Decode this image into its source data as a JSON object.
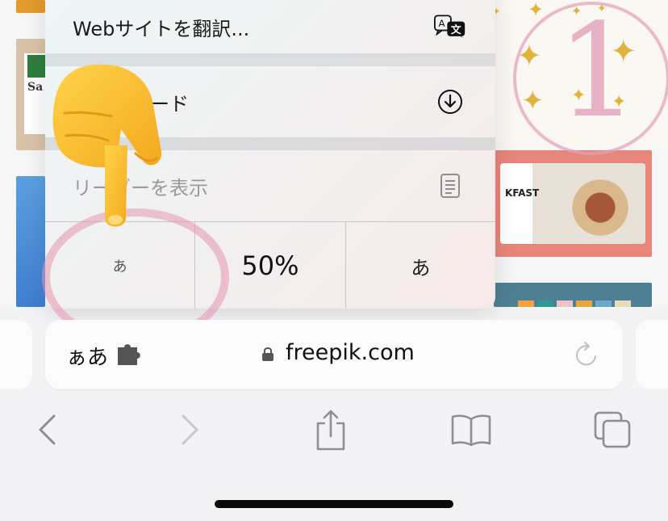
{
  "menu": {
    "translate_label": "Webサイトを翻訳...",
    "download_label": "ダウンロード",
    "reader_label": "リーダーを表示",
    "zoom_smaller": "あ",
    "zoom_level": "50%",
    "zoom_larger": "あ"
  },
  "address_bar": {
    "text_size_button": "ぁあ",
    "url": "freepik.com"
  },
  "background": {
    "salad_text": "Sa",
    "breakfast_text": "KFAST",
    "badge_number": "1"
  },
  "icons": {
    "translate": "translate-icon",
    "download": "download-icon",
    "reader": "reader-icon",
    "extension": "puzzle-icon",
    "lock": "lock-icon",
    "reload": "reload-icon",
    "back": "chevron-left-icon",
    "forward": "chevron-right-icon",
    "share": "share-icon",
    "bookmarks": "book-icon",
    "tabs": "tabs-icon",
    "pointer": "pointing-hand-icon"
  },
  "colors": {
    "annotation_pink": "#e396b4",
    "sparkle_gold": "#e0b33a"
  }
}
